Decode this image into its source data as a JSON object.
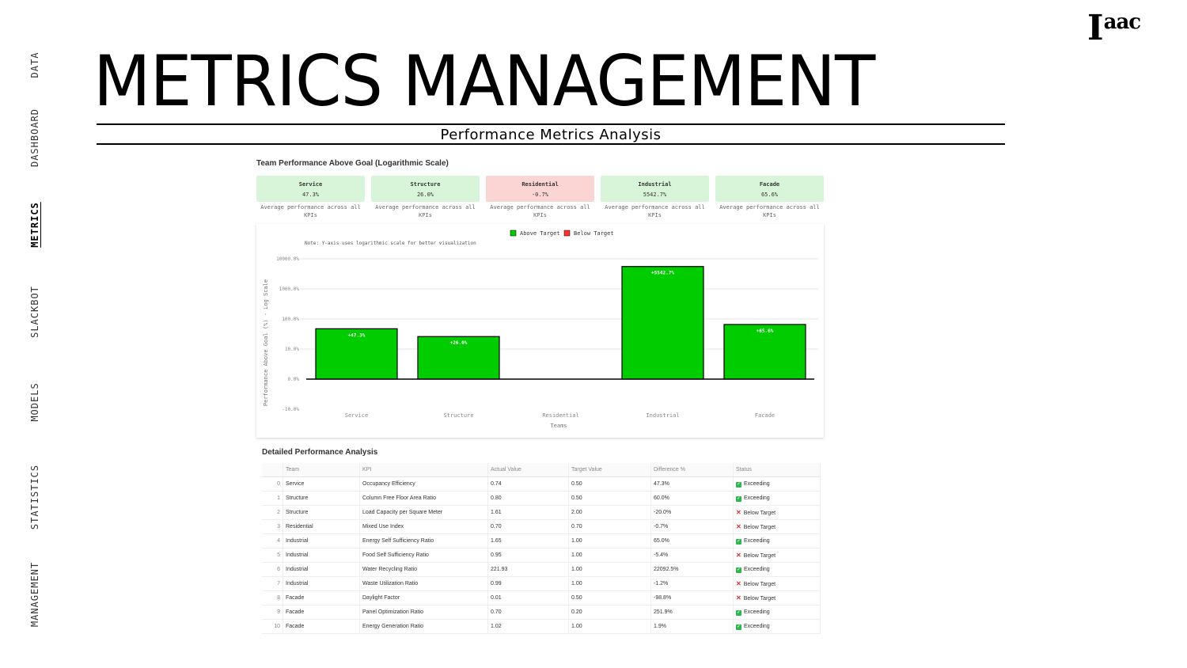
{
  "nav": {
    "items": [
      "DATA",
      "DASHBOARD",
      "METRICS",
      "SLACKBOT",
      "MODELS",
      "STATISTICS",
      "MANAGEMENT"
    ],
    "active": "METRICS"
  },
  "logo": {
    "main": "I",
    "sup": "aac"
  },
  "page": {
    "title": "METRICS MANAGEMENT",
    "subtitle": "Performance Metrics Analysis"
  },
  "section": {
    "chart_title": "Team Performance Above Goal (Logarithmic Scale)",
    "table_title": "Detailed Performance Analysis"
  },
  "cards": [
    {
      "name": "Service",
      "value": "47.3%",
      "desc": "Average performance across all KPIs",
      "status": "above"
    },
    {
      "name": "Structure",
      "value": "26.0%",
      "desc": "Average performance across all KPIs",
      "status": "above"
    },
    {
      "name": "Residential",
      "value": "-0.7%",
      "desc": "Average performance across all KPIs",
      "status": "below"
    },
    {
      "name": "Industrial",
      "value": "5542.7%",
      "desc": "Average performance across all KPIs",
      "status": "above"
    },
    {
      "name": "Facade",
      "value": "65.6%",
      "desc": "Average performance across all KPIs",
      "status": "above"
    }
  ],
  "colors": {
    "above": "#00cc00",
    "below": "#ff3333",
    "card_green": "#d9f5d9",
    "card_red": "#fbd4d4"
  },
  "chart_data": {
    "type": "bar",
    "note": "Note: Y-axis uses logarithmic scale for better visualization",
    "legend": [
      "Above Target",
      "Below Target"
    ],
    "legend_position": "top",
    "categories": [
      "Service",
      "Structure",
      "Residential",
      "Industrial",
      "Facade"
    ],
    "values": [
      47.3,
      26.0,
      -0.7,
      5542.7,
      65.6
    ],
    "data_labels": [
      "+47.3%",
      "+26.0%",
      "",
      "+5542.7%",
      "+65.6%"
    ],
    "yscale": "log",
    "ytick_labels": [
      "10000.0%",
      "1000.0%",
      "100.0%",
      "10.0%",
      "0.0%",
      "-10.0%"
    ],
    "xlabel": "Teams",
    "ylabel": "Performance Above Goal (%) - Log Scale",
    "grid": true
  },
  "table": {
    "columns": [
      "",
      "Team",
      "KPI",
      "Actual Value",
      "Target Value",
      "Difference %",
      "Status"
    ],
    "rows": [
      [
        "0",
        "Service",
        "Occupancy Efficiency",
        "0.74",
        "0.50",
        "47.3%",
        "Exceeding"
      ],
      [
        "1",
        "Structure",
        "Column Free Floor Area Ratio",
        "0.80",
        "0.50",
        "60.0%",
        "Exceeding"
      ],
      [
        "2",
        "Structure",
        "Load Capacity per Square Meter",
        "1.61",
        "2.00",
        "-20.0%",
        "Below Target"
      ],
      [
        "3",
        "Residential",
        "Mixed Use Index",
        "0.70",
        "0.70",
        "-0.7%",
        "Below Target"
      ],
      [
        "4",
        "Industrial",
        "Energy Self Sufficiency Ratio",
        "1.65",
        "1.00",
        "65.0%",
        "Exceeding"
      ],
      [
        "5",
        "Industrial",
        "Food Self Sufficiency Ratio",
        "0.95",
        "1.00",
        "-5.4%",
        "Below Target"
      ],
      [
        "6",
        "Industrial",
        "Water Recycling Ratio",
        "221.93",
        "1.00",
        "22092.5%",
        "Exceeding"
      ],
      [
        "7",
        "Industrial",
        "Waste Utilization Ratio",
        "0.99",
        "1.00",
        "-1.2%",
        "Below Target"
      ],
      [
        "8",
        "Facade",
        "Daylight Factor",
        "0.01",
        "0.50",
        "-98.8%",
        "Below Target"
      ],
      [
        "9",
        "Facade",
        "Panel Optimization Ratio",
        "0.70",
        "0.20",
        "251.9%",
        "Exceeding"
      ],
      [
        "10",
        "Facade",
        "Energy Generation Ratio",
        "1.02",
        "1.00",
        "1.9%",
        "Exceeding"
      ]
    ]
  }
}
